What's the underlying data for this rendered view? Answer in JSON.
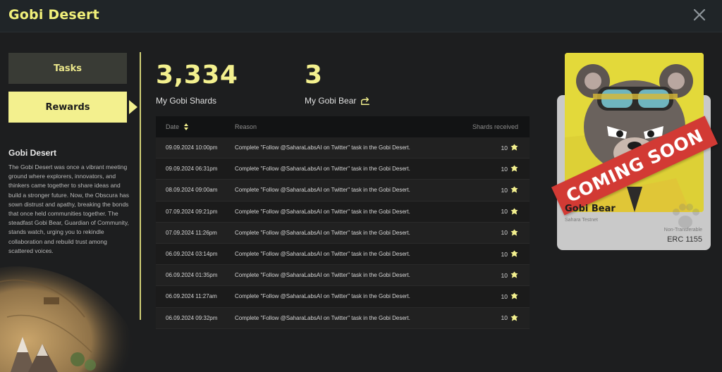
{
  "header": {
    "title": "Gobi Desert"
  },
  "nav": {
    "tasks_label": "Tasks",
    "rewards_label": "Rewards"
  },
  "description": {
    "title": "Gobi Desert",
    "body": "The Gobi Desert was once a vibrant meeting ground where explorers, innovators, and thinkers came together to share ideas and build a stronger future. Now, the Obscura has sown distrust and apathy, breaking the bonds that once held communities together. The steadfast Gobi Bear, Guardian of Community, stands watch, urging you to rekindle collaboration and rebuild trust among scattered voices."
  },
  "stats": {
    "shards_value": "3,334",
    "shards_label": "My Gobi Shards",
    "bears_value": "3",
    "bears_label": "My Gobi Bear"
  },
  "table": {
    "headers": {
      "date": "Date",
      "reason": "Reason",
      "shards": "Shards received"
    },
    "rows": [
      {
        "date": "09.09.2024 10:00pm",
        "reason": "Complete \"Follow @SaharaLabsAI on Twitter\" task in the Gobi Desert.",
        "shards": "10"
      },
      {
        "date": "09.09.2024 06:31pm",
        "reason": "Complete \"Follow @SaharaLabsAI on Twitter\" task in the Gobi Desert.",
        "shards": "10"
      },
      {
        "date": "08.09.2024 09:00am",
        "reason": "Complete \"Follow @SaharaLabsAI on Twitter\" task in the Gobi Desert.",
        "shards": "10"
      },
      {
        "date": "07.09.2024 09:21pm",
        "reason": "Complete \"Follow @SaharaLabsAI on Twitter\" task in the Gobi Desert.",
        "shards": "10"
      },
      {
        "date": "07.09.2024 11:26pm",
        "reason": "Complete \"Follow @SaharaLabsAI on Twitter\" task in the Gobi Desert.",
        "shards": "10"
      },
      {
        "date": "06.09.2024 03:14pm",
        "reason": "Complete \"Follow @SaharaLabsAI on Twitter\" task in the Gobi Desert.",
        "shards": "10"
      },
      {
        "date": "06.09.2024 01:35pm",
        "reason": "Complete \"Follow @SaharaLabsAI on Twitter\" task in the Gobi Desert.",
        "shards": "10"
      },
      {
        "date": "06.09.2024 11:27am",
        "reason": "Complete \"Follow @SaharaLabsAI on Twitter\" task in the Gobi Desert.",
        "shards": "10"
      },
      {
        "date": "06.09.2024 09:32pm",
        "reason": "Complete \"Follow @SaharaLabsAI on Twitter\" task in the Gobi Desert.",
        "shards": "10"
      }
    ]
  },
  "card": {
    "ribbon": "COMING SOON",
    "name": "Gobi Bear",
    "network": "Sahara Testnet",
    "transfer": "Non-Transferable",
    "standard": "ERC 1155"
  },
  "icons": {
    "close": "close-icon",
    "share": "share-arrow-icon",
    "sort": "sort-icon",
    "shard": "shard-icon",
    "paw": "paw-icon"
  },
  "colors": {
    "accent": "#f3f08e",
    "title": "#f1f07a",
    "ribbon": "#d23a34",
    "background": "#1d1e1f"
  }
}
